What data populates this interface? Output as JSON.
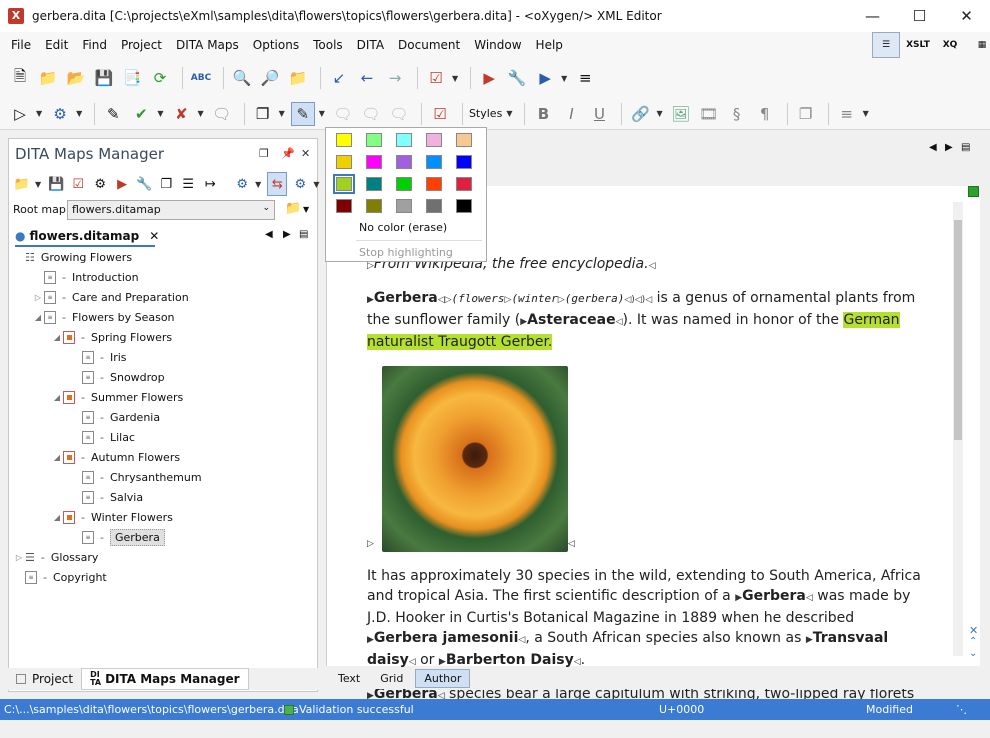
{
  "window": {
    "title": "gerbera.dita [C:\\projects\\eXml\\samples\\dita\\flowers\\topics\\flowers\\gerbera.dita] - <oXygen/> XML Editor"
  },
  "menubar": [
    "File",
    "Edit",
    "Find",
    "Project",
    "DITA Maps",
    "Options",
    "Tools",
    "DITA",
    "Document",
    "Window",
    "Help"
  ],
  "toolbar": {
    "styles_label": "Styles"
  },
  "perspectives": [
    "XSLT",
    "XQ"
  ],
  "dmm": {
    "title": "DITA Maps Manager",
    "root_label": "Root map:",
    "root_value": "flowers.ditamap",
    "tab_label": "flowers.ditamap",
    "tree": [
      {
        "label": "Growing Flowers",
        "level": 0,
        "icon": "root"
      },
      {
        "label": "Introduction",
        "level": 1,
        "icon": "doc"
      },
      {
        "label": "Care and Preparation",
        "level": 1,
        "icon": "doc",
        "twist": "closed"
      },
      {
        "label": "Flowers by Season",
        "level": 1,
        "icon": "doc",
        "twist": "open"
      },
      {
        "label": "Spring Flowers",
        "level": 2,
        "icon": "map",
        "twist": "open"
      },
      {
        "label": "Iris",
        "level": 3,
        "icon": "doc"
      },
      {
        "label": "Snowdrop",
        "level": 3,
        "icon": "doc"
      },
      {
        "label": "Summer Flowers",
        "level": 2,
        "icon": "map",
        "twist": "open"
      },
      {
        "label": "Gardenia",
        "level": 3,
        "icon": "doc"
      },
      {
        "label": "Lilac",
        "level": 3,
        "icon": "doc"
      },
      {
        "label": "Autumn Flowers",
        "level": 2,
        "icon": "map",
        "twist": "open"
      },
      {
        "label": "Chrysanthemum",
        "level": 3,
        "icon": "doc"
      },
      {
        "label": "Salvia",
        "level": 3,
        "icon": "doc"
      },
      {
        "label": "Winter Flowers",
        "level": 2,
        "icon": "map",
        "twist": "open"
      },
      {
        "label": "Gerbera",
        "level": 3,
        "icon": "doc",
        "selected": true
      },
      {
        "label": "Glossary",
        "level": 0,
        "icon": "gloss",
        "twist": "closed"
      },
      {
        "label": "Copyright",
        "level": 0,
        "icon": "doc"
      }
    ]
  },
  "palette": {
    "colors": [
      "#ffff00",
      "#80ff80",
      "#80ffff",
      "#f0b0e0",
      "#f8c890",
      "#f0d000",
      "#ff00ff",
      "#a060e0",
      "#0090ff",
      "#0000ff",
      "#a0d020",
      "#008080",
      "#00d000",
      "#ff4000",
      "#e02040",
      "#800000",
      "#808000",
      "#a0a0a0",
      "#707070",
      "#000000"
    ],
    "no_color": "No color (erase)",
    "stop": "Stop highlighting"
  },
  "doc": {
    "p1": "From Wikipedia, the free encyclopedia.",
    "p2a": "Gerbera",
    "p2flowers": "(flowers",
    "p2winter": "(winter",
    "p2gerbera": "(gerbera)",
    "p2b": " is a genus of ornamental plants from the sunflower family (",
    "p2c": "Asteraceae",
    "p2d": "). It was named in honor of the ",
    "p2hl": "German naturalist Traugott Gerber.",
    "p3a": "It has approximately 30 species in the wild, extending to South America, Africa and tropical Asia. The first scientific description of a ",
    "p3b": "Gerbera",
    "p3c": " was made by J.D. Hooker in Curtis's Botanical Magazine in 1889 when he described ",
    "p3d": "Gerbera jamesonii",
    "p3e": ", a South African species also known as ",
    "p3f": "Transvaal daisy",
    "p3g": " or ",
    "p3h": "Barberton Daisy",
    "p3i": ".",
    "p4a": "Gerbera",
    "p4b": " species bear a large capitulum with striking, two-lipped ray florets in"
  },
  "bottom_tabs": [
    "Text",
    "Grid",
    "Author"
  ],
  "panel_tabs": [
    "Project",
    "DITA Maps Manager"
  ],
  "status": {
    "path": "C:\\...\\samples\\dita\\flowers\\topics\\flowers\\gerbera.dita",
    "validation": "Validation successful",
    "unicode": "U+0000",
    "modified": "Modified"
  }
}
